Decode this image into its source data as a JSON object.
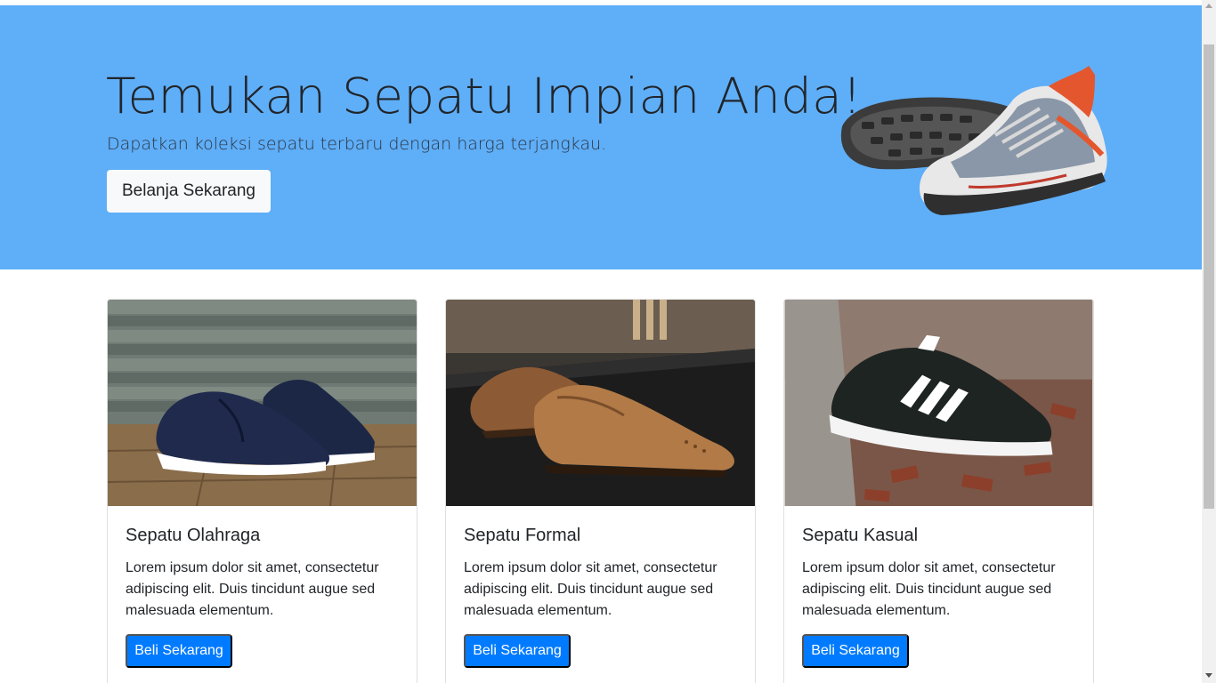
{
  "hero": {
    "title": "Temukan Sepatu Impian Anda!",
    "subtitle": "Dapatkan koleksi sepatu terbaru dengan harga terjangkau.",
    "button_label": "Belanja Sekarang",
    "image_icon": "running-shoe-image",
    "background_color": "#5faef8"
  },
  "products": [
    {
      "title": "Sepatu Olahraga",
      "description": "Lorem ipsum dolor sit amet, consectetur adipiscing elit. Duis tincidunt augue sed malesuada elementum.",
      "button_label": "Beli Sekarang",
      "image_icon": "sport-sneaker-photo"
    },
    {
      "title": "Sepatu Formal",
      "description": "Lorem ipsum dolor sit amet, consectetur adipiscing elit. Duis tincidunt augue sed malesuada elementum.",
      "button_label": "Beli Sekarang",
      "image_icon": "formal-oxford-shoe-photo"
    },
    {
      "title": "Sepatu Kasual",
      "description": "Lorem ipsum dolor sit amet, consectetur adipiscing elit. Duis tincidunt augue sed malesuada elementum.",
      "button_label": "Beli Sekarang",
      "image_icon": "casual-sneaker-photo"
    }
  ],
  "colors": {
    "primary_button": "#007bff",
    "light_button": "#f8f9fa",
    "text": "#212529"
  }
}
